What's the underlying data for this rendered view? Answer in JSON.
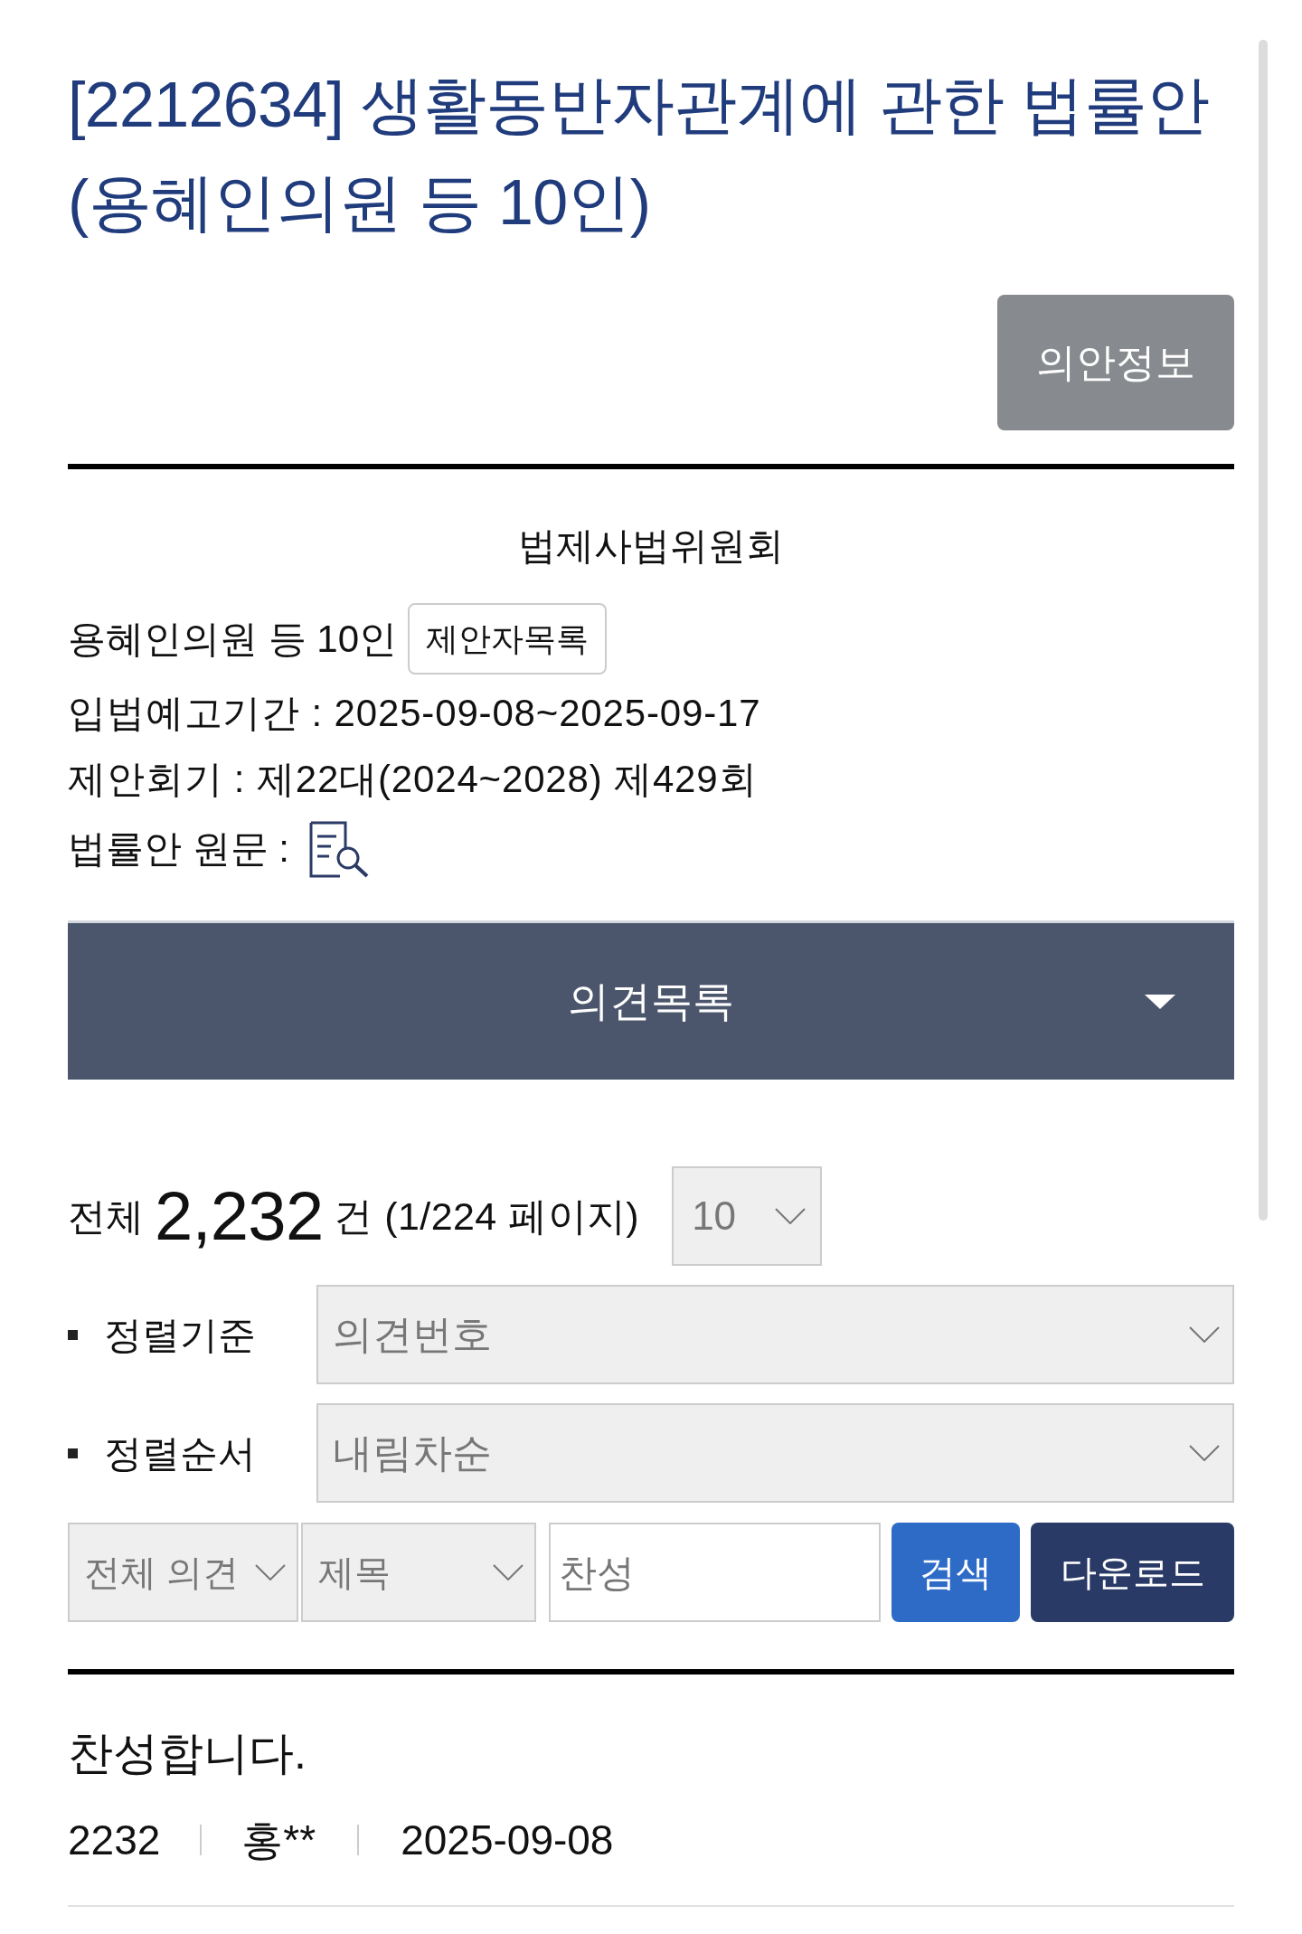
{
  "bill": {
    "title_lines": [
      "[2212634] 생활동반자관계에 관한 법률안",
      "(용혜인의원 등 10인)"
    ],
    "info_button": "의안정보"
  },
  "details": {
    "committee": "법제사법위원회",
    "proposer": "용혜인의원 등 10인",
    "proposer_button": "제안자목록",
    "lines": [
      "입법예고기간 : 2025-09-08~2025-09-17",
      "제안회기 : 제22대(2024~2028) 제429회"
    ],
    "original_text_label": "법률안 원문 :"
  },
  "opinions_panel": {
    "title": "의견목록"
  },
  "summary": {
    "total_label": "전체",
    "count": "2,232",
    "unit": "건 (1/224 페이지)",
    "page_size": "10"
  },
  "sort": [
    {
      "label": "정렬기준",
      "value": "의견번호"
    },
    {
      "label": "정렬순서",
      "value": "내림차순"
    }
  ],
  "search": {
    "scope": "전체 의견",
    "field": "제목",
    "query": "찬성",
    "search_button": "검색",
    "download_button": "다운로드"
  },
  "opinions": [
    {
      "title": "찬성합니다.",
      "number": "2232",
      "author": "홍**",
      "date": "2025-09-08"
    }
  ]
}
